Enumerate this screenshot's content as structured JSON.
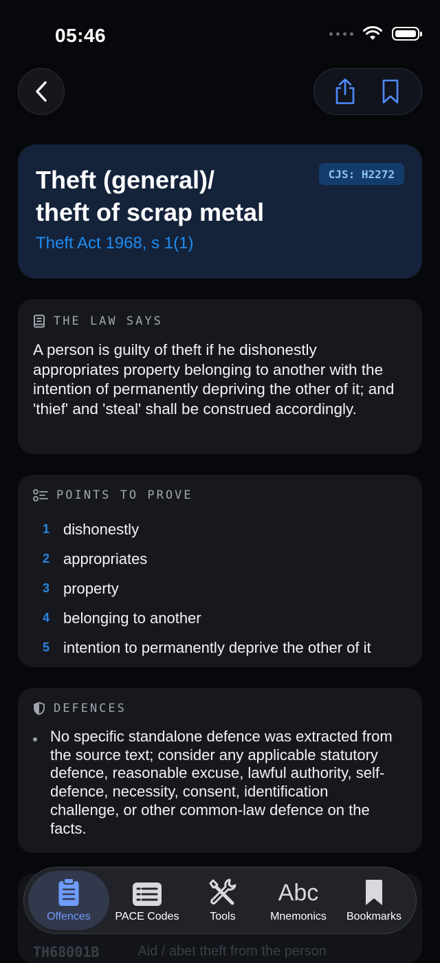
{
  "status_bar": {
    "time": "05:46"
  },
  "offence": {
    "title_line1": "Theft (general)/",
    "title_line2": "theft of scrap metal",
    "act": "Theft Act 1968, s 1(1)",
    "cjs_code": "CJS: H2272"
  },
  "law_says": {
    "heading": "THE LAW SAYS",
    "text": "A person is guilty of theft if he dishonestly appropriates property belonging to another with the intention of permanently depriving the other of it; and 'thief' and 'steal' shall be construed accordingly."
  },
  "points_to_prove": {
    "heading": "POINTS TO PROVE",
    "items": [
      {
        "num": "1",
        "text": "dishonestly"
      },
      {
        "num": "2",
        "text": "appropriates"
      },
      {
        "num": "3",
        "text": "property"
      },
      {
        "num": "4",
        "text": "belonging to another"
      },
      {
        "num": "5",
        "text": "intention to permanently deprive the other of it"
      }
    ]
  },
  "defences": {
    "heading": "DEFENCES",
    "items": [
      "No specific standalone defence was extracted from the source text; consider any applicable statutory defence, reasonable excuse, lawful authority, self-defence, necessity, consent, identification challenge, or other common-law defence on the facts."
    ]
  },
  "related_peek": {
    "code": "TH68001B",
    "text": "Aid / abet theft from the person"
  },
  "tab_bar": {
    "tabs": [
      {
        "label": "Offences",
        "icon": "clipboard-icon",
        "active": true
      },
      {
        "label": "PACE Codes",
        "icon": "list-card-icon",
        "active": false
      },
      {
        "label": "Tools",
        "icon": "tools-icon",
        "active": false
      },
      {
        "label": "Mnemonics",
        "icon": "abc-icon",
        "glyph": "Abc",
        "active": false
      },
      {
        "label": "Bookmarks",
        "icon": "bookmark-icon",
        "active": false
      }
    ]
  },
  "colors": {
    "background": "#07080b",
    "accent_blue": "#1f8cf0",
    "tab_active": "#6e9cff",
    "card": "#16181e",
    "hero_card": "#14223a"
  }
}
